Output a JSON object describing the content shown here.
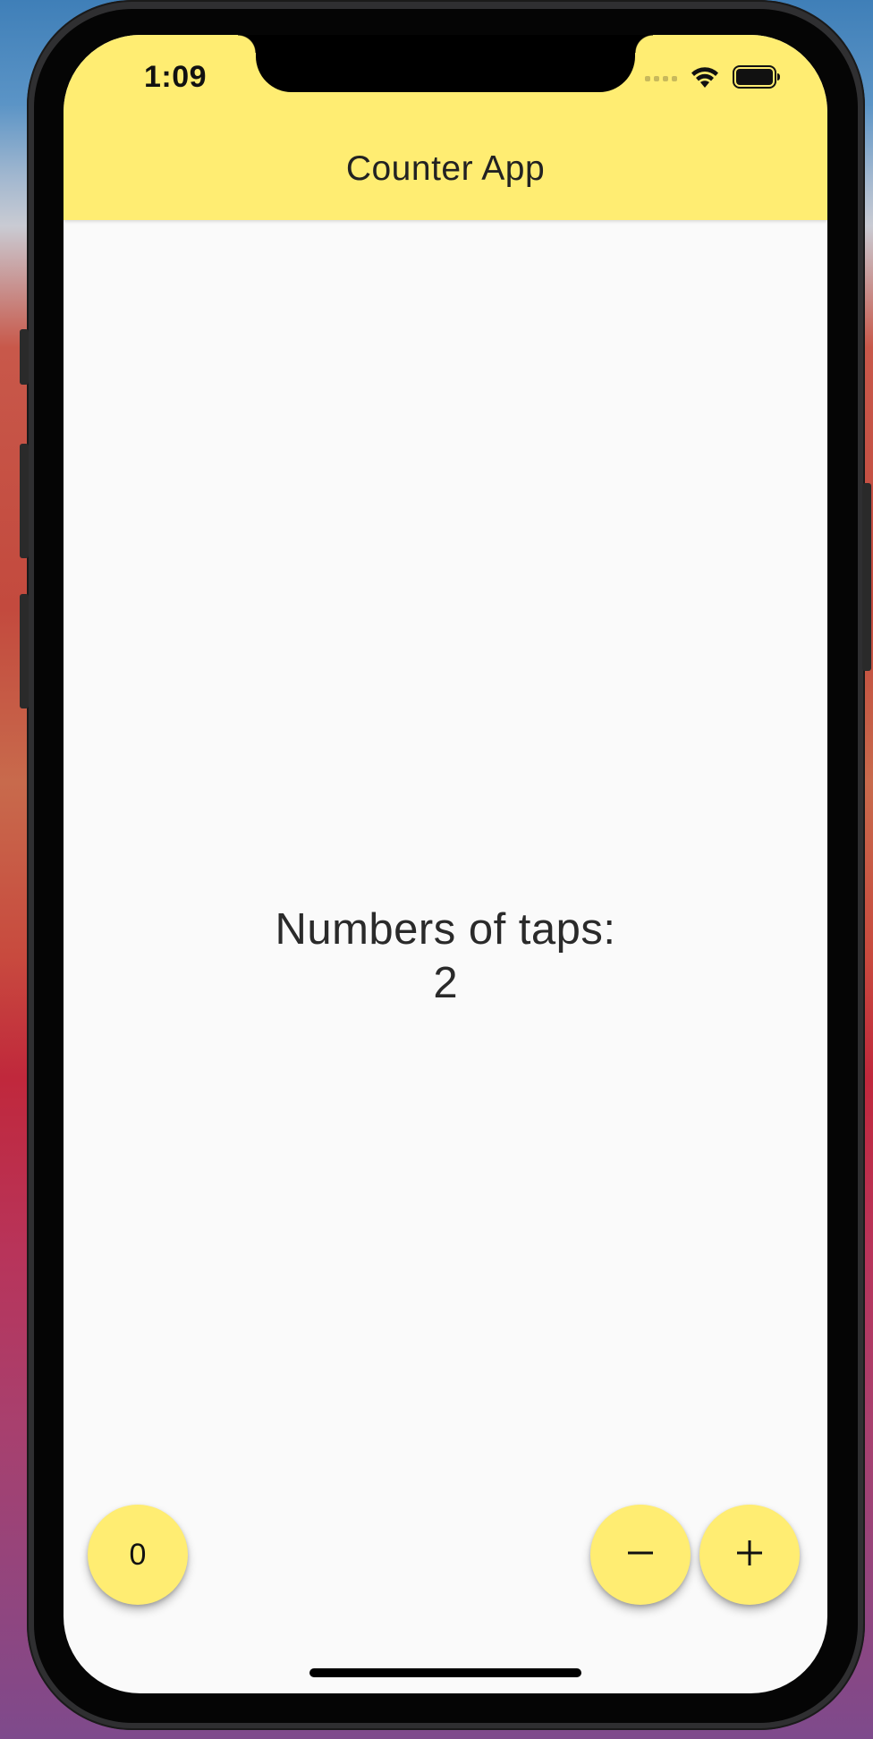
{
  "status_bar": {
    "time": "1:09",
    "icons": [
      "cellular-signal-icon",
      "wifi-icon",
      "battery-icon"
    ]
  },
  "app_bar": {
    "title": "Counter App",
    "color": "#ffed72"
  },
  "counter": {
    "label": "Numbers of taps:",
    "value": "2"
  },
  "buttons": {
    "reset_label": "0",
    "decrement_icon": "minus-icon",
    "increment_icon": "plus-icon"
  },
  "colors": {
    "accent": "#ffed72",
    "background": "#fafafa",
    "text": "#2a2a2a"
  }
}
